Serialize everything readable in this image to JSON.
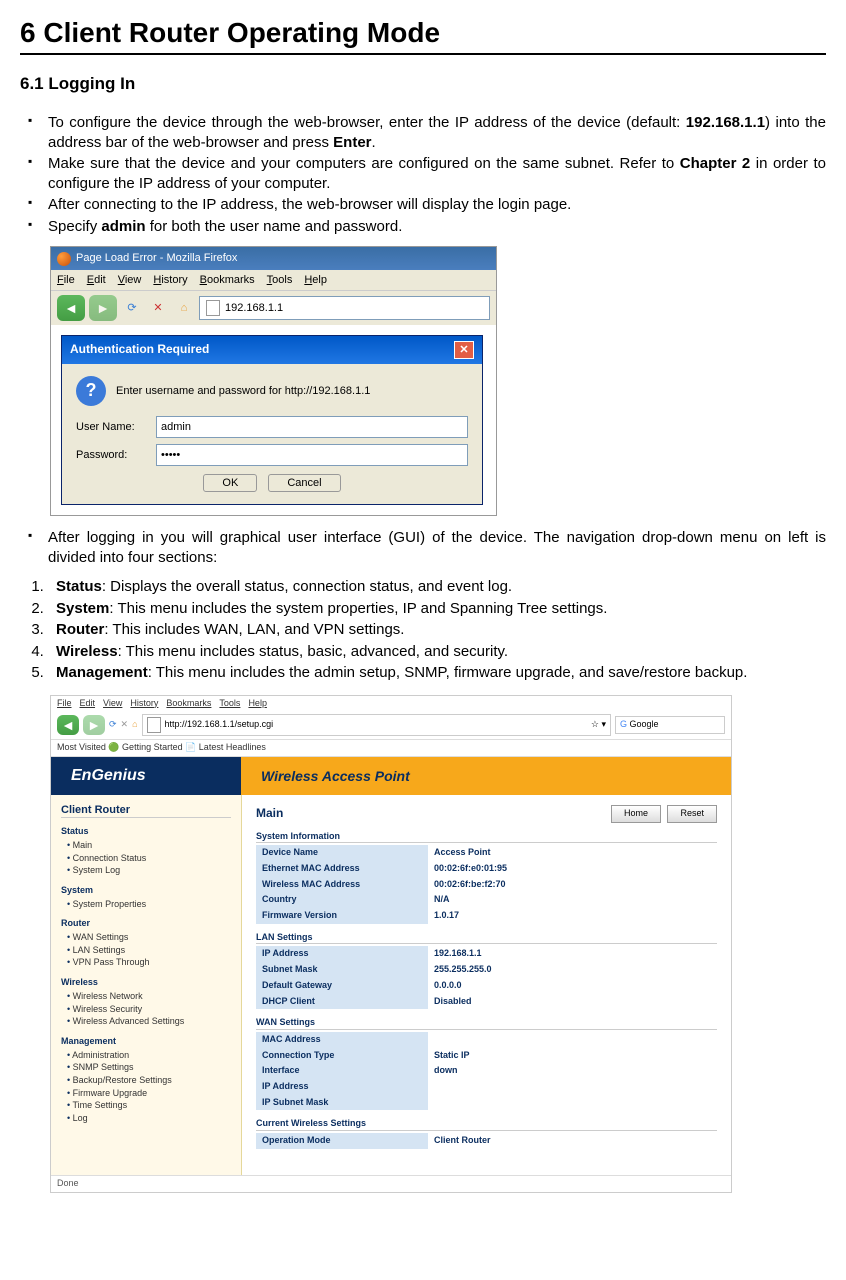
{
  "doc": {
    "chapter_title": "6  Client Router Operating Mode",
    "section_title": "6.1 Logging In",
    "bullets_1": [
      "To configure the device through the web-browser, enter the IP address of the device (default: <b>192.168.1.1</b>) into the address bar of the web-browser and press <b>Enter</b>.",
      "Make sure that the device and your computers are configured on the same subnet. Refer to <b>Chapter 2</b> in order to configure the IP address of your computer.",
      "After connecting to the IP address, the web-browser will display the login page.",
      "Specify <b>admin</b> for both the user name and password."
    ],
    "bullets_2": [
      "After logging in you will graphical user interface (GUI) of the device. The navigation drop-down menu on left is divided into four sections:"
    ],
    "numbers": [
      "<b>Status</b>: Displays the overall status, connection status, and event log.",
      "<b>System</b>: This menu includes the system properties, IP and Spanning Tree settings.",
      "<b>Router</b>: This includes WAN, LAN, and VPN settings.",
      "<b>Wireless</b>: This menu includes status, basic, advanced, and security.",
      "<b>Management</b>: This menu includes the admin setup, SNMP, firmware upgrade, and save/restore backup."
    ]
  },
  "firefox1": {
    "title": "Page Load Error - Mozilla Firefox",
    "menu": [
      "File",
      "Edit",
      "View",
      "History",
      "Bookmarks",
      "Tools",
      "Help"
    ],
    "url": "192.168.1.1"
  },
  "auth": {
    "title": "Authentication Required",
    "message": "Enter username and password for http://192.168.1.1",
    "user_label": "User Name:",
    "user_value": "admin",
    "pass_label": "Password:",
    "pass_value": "•••••",
    "ok": "OK",
    "cancel": "Cancel"
  },
  "engenius": {
    "menu": [
      "File",
      "Edit",
      "View",
      "History",
      "Bookmarks",
      "Tools",
      "Help"
    ],
    "url": "http://192.168.1.1/setup.cgi",
    "search_placeholder": "Google",
    "bookmarks_label": "Most Visited  🟢 Getting Started  📄 Latest Headlines",
    "logo": "EnGenius",
    "title": "Wireless Access Point",
    "mode": "Client Router",
    "sidebar": {
      "groups": [
        {
          "name": "Status",
          "items": [
            "Main",
            "Connection Status",
            "System Log"
          ]
        },
        {
          "name": "System",
          "items": [
            "System Properties"
          ]
        },
        {
          "name": "Router",
          "items": [
            "WAN Settings",
            "LAN Settings",
            "VPN Pass Through"
          ]
        },
        {
          "name": "Wireless",
          "items": [
            "Wireless Network",
            "Wireless Security",
            "Wireless Advanced Settings"
          ]
        },
        {
          "name": "Management",
          "items": [
            "Administration",
            "SNMP Settings",
            "Backup/Restore Settings",
            "Firmware Upgrade",
            "Time Settings",
            "Log"
          ]
        }
      ]
    },
    "main": {
      "title": "Main",
      "home_btn": "Home",
      "reset_btn": "Reset",
      "sections": [
        {
          "header": "System Information",
          "rows": [
            [
              "Device Name",
              "Access Point"
            ],
            [
              "Ethernet MAC Address",
              "00:02:6f:e0:01:95"
            ],
            [
              "Wireless MAC Address",
              "00:02:6f:be:f2:70"
            ],
            [
              "Country",
              "N/A"
            ],
            [
              "Firmware Version",
              "1.0.17"
            ]
          ]
        },
        {
          "header": "LAN Settings",
          "rows": [
            [
              "IP Address",
              "192.168.1.1"
            ],
            [
              "Subnet Mask",
              "255.255.255.0"
            ],
            [
              "Default Gateway",
              "0.0.0.0"
            ],
            [
              "DHCP Client",
              "Disabled"
            ]
          ]
        },
        {
          "header": "WAN Settings",
          "rows": [
            [
              "MAC Address",
              ""
            ],
            [
              "Connection Type",
              "Static IP"
            ],
            [
              "Interface",
              "down"
            ],
            [
              "IP Address",
              ""
            ],
            [
              "IP Subnet Mask",
              ""
            ]
          ]
        },
        {
          "header": "Current Wireless Settings",
          "rows": [
            [
              "Operation Mode",
              "Client Router"
            ]
          ]
        }
      ]
    },
    "status": "Done"
  }
}
